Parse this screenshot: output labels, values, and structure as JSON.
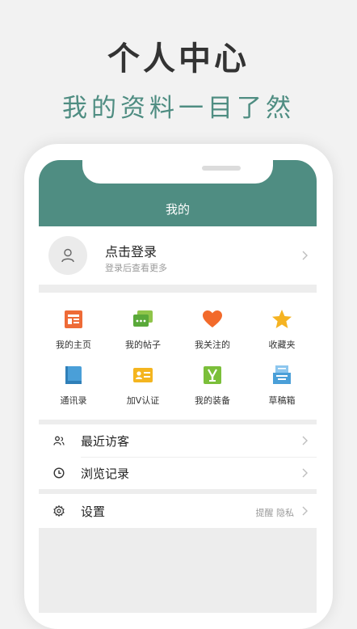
{
  "promo": {
    "title": "个人中心",
    "subtitle": "我的资料一目了然"
  },
  "colors": {
    "accent": "#4f8d82",
    "background": "#f2f2f2"
  },
  "header": {
    "title": "我的"
  },
  "profile": {
    "title": "点击登录",
    "subtitle": "登录后查看更多",
    "icon": "user-icon"
  },
  "grid": [
    {
      "label": "我的主页",
      "icon": "homepage-icon"
    },
    {
      "label": "我的帖子",
      "icon": "posts-icon"
    },
    {
      "label": "我关注的",
      "icon": "heart-icon"
    },
    {
      "label": "收藏夹",
      "icon": "star-icon"
    },
    {
      "label": "通讯录",
      "icon": "contacts-book-icon"
    },
    {
      "label": "加V认证",
      "icon": "id-card-icon"
    },
    {
      "label": "我的装备",
      "icon": "equipment-icon"
    },
    {
      "label": "草稿箱",
      "icon": "drafts-tray-icon"
    }
  ],
  "list": [
    {
      "label": "最近访客",
      "icon": "visitors-icon"
    },
    {
      "label": "浏览记录",
      "icon": "clock-icon"
    }
  ],
  "settings": {
    "label": "设置",
    "hint": "提醒 隐私",
    "icon": "gear-icon"
  }
}
